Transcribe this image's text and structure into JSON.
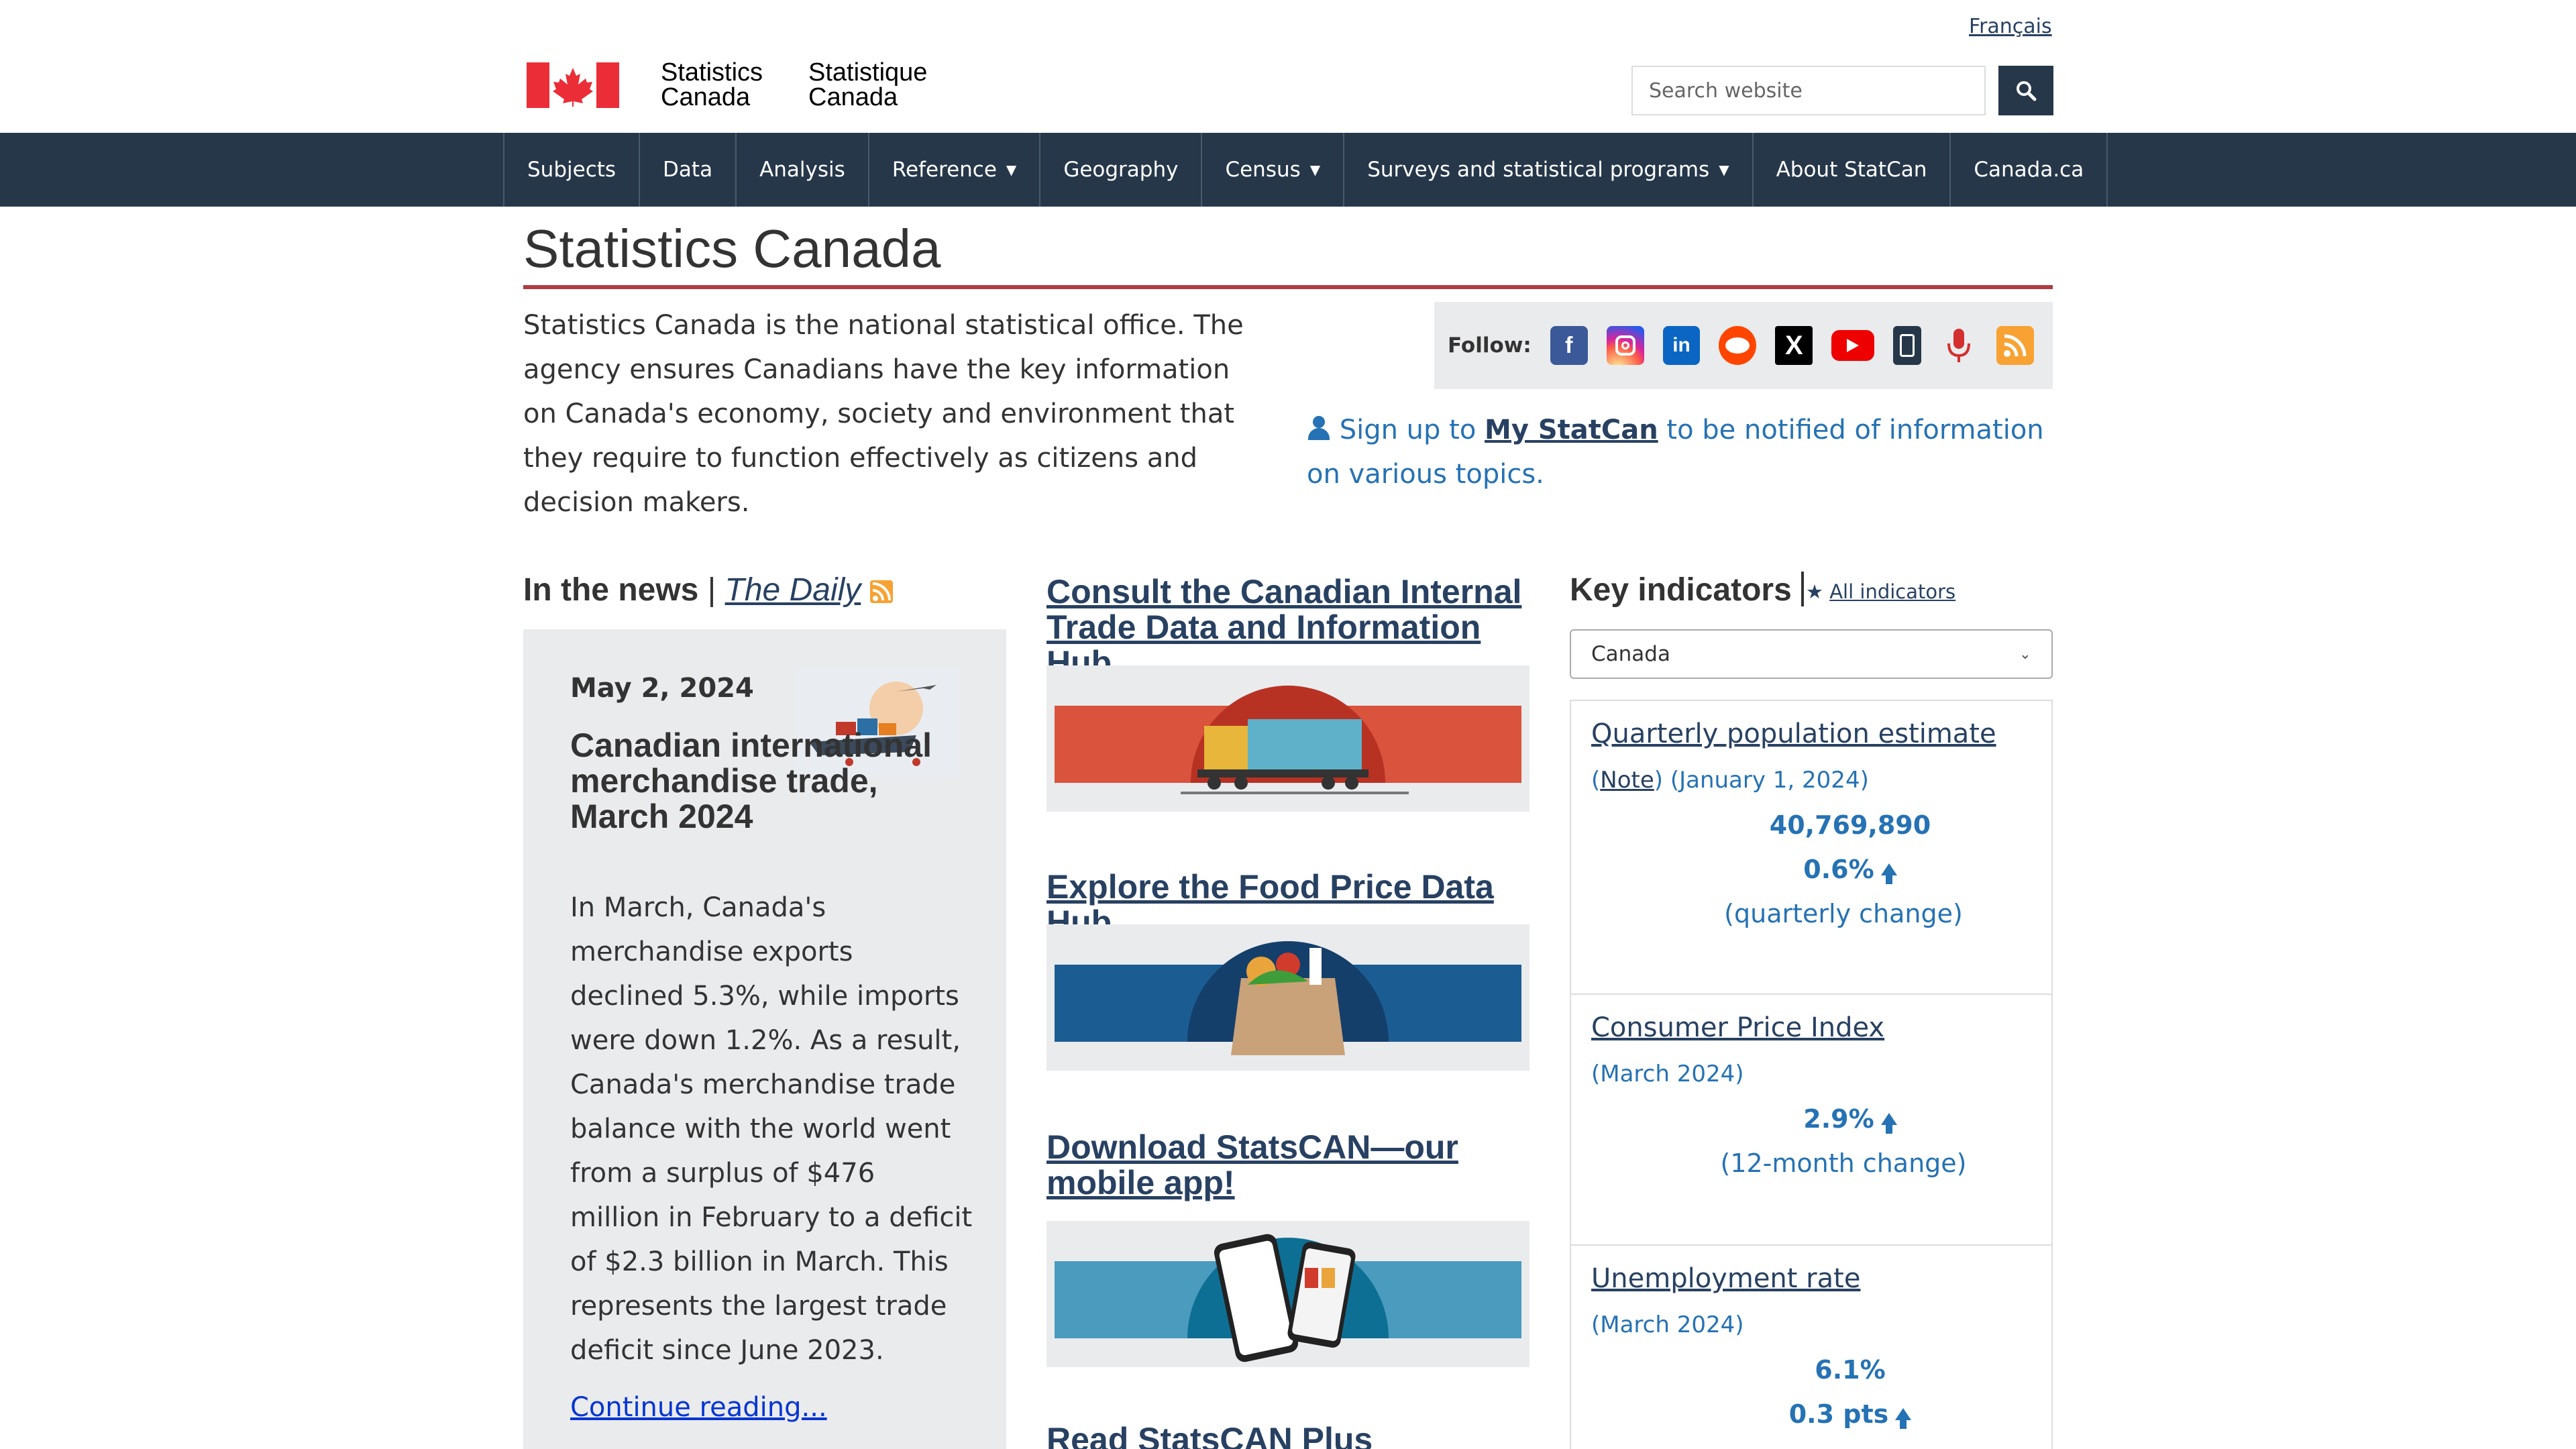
{
  "header": {
    "lang_toggle": "Français",
    "signature_en": [
      "Statistics",
      "Canada"
    ],
    "signature_fr": [
      "Statistique",
      "Canada"
    ],
    "search_placeholder": "Search website"
  },
  "nav": {
    "items": [
      {
        "label": "Subjects",
        "dropdown": false
      },
      {
        "label": "Data",
        "dropdown": false
      },
      {
        "label": "Analysis",
        "dropdown": false
      },
      {
        "label": "Reference",
        "dropdown": true
      },
      {
        "label": "Geography",
        "dropdown": false
      },
      {
        "label": "Census",
        "dropdown": true
      },
      {
        "label": "Surveys and statistical programs",
        "dropdown": true
      },
      {
        "label": "About StatCan",
        "dropdown": false
      },
      {
        "label": "Canada.ca",
        "dropdown": false
      }
    ]
  },
  "page": {
    "title": "Statistics Canada",
    "intro": "Statistics Canada is the national statistical office. The agency ensures Canadians have the key information on Canada's economy, society and environment that they require to function effectively as citizens and decision makers."
  },
  "follow": {
    "label": "Follow:",
    "icons": [
      "facebook-icon",
      "instagram-icon",
      "linkedin-icon",
      "reddit-icon",
      "x-icon",
      "youtube-icon",
      "statscan-app-icon",
      "podcast-icon",
      "rss-icon"
    ]
  },
  "signup": {
    "prefix": "Sign up to",
    "link": "My StatCan",
    "suffix": "to be notified of information on various topics."
  },
  "news": {
    "heading": "In the news",
    "separator": "|",
    "daily_link": "The Daily",
    "date": "May 2, 2024",
    "title": "Canadian international merchandise trade, March 2024",
    "body": "In March, Canada's merchandise exports declined 5.3%, while imports were down 1.2%. As a result, Canada's merchandise trade balance with the world went from a surplus of $476 million in February to a deficit of $2.3 billion in March. This represents the largest trade deficit since June 2023.",
    "more": "Continue reading..."
  },
  "features": [
    {
      "title": "Consult the Canadian Internal Trade Data and Information Hub"
    },
    {
      "title": "Explore the Food Price Data Hub"
    },
    {
      "title": "Download StatsCAN—our mobile app!"
    },
    {
      "title": "Read StatsCAN Plus"
    }
  ],
  "indicators": {
    "heading": "Key indicators",
    "all_link": "All indicators",
    "region": "Canada",
    "items": [
      {
        "title": "Quarterly population estimate",
        "note": "Note",
        "period": "(January 1, 2024)",
        "value": "40,769,890",
        "change": "0.6%",
        "change_desc": "(quarterly change)"
      },
      {
        "title": "Consumer Price Index",
        "period": "(March 2024)",
        "change": "2.9%",
        "change_desc": "(12-month change)"
      },
      {
        "title": "Unemployment rate",
        "period": "(March 2024)",
        "value": "6.1%",
        "change": "0.3 pts"
      }
    ]
  },
  "colors": {
    "nav_bg": "#26374a",
    "title_rule": "#af3c43",
    "link": "#284162",
    "accent_blue": "#2572b4"
  }
}
